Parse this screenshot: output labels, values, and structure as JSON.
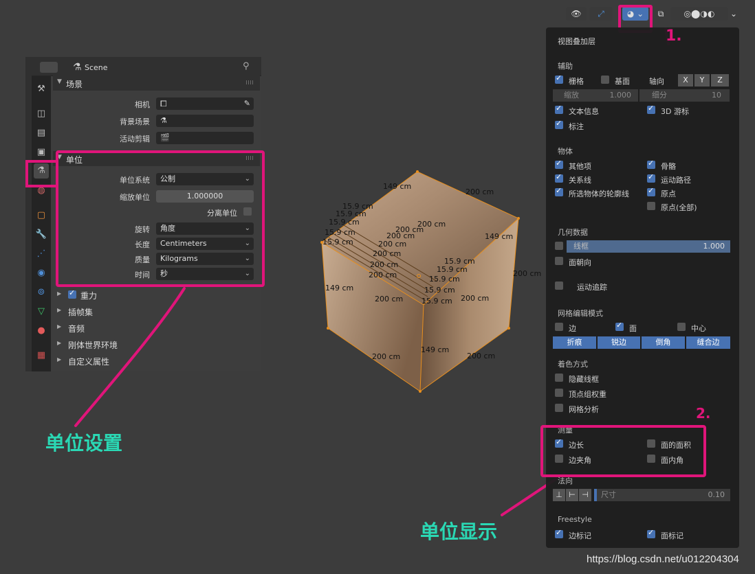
{
  "props": {
    "header_title": "Scene",
    "scene_section": "场景",
    "camera_label": "相机",
    "bg_scene_label": "背景场景",
    "active_clip_label": "活动剪辑",
    "units_section": "单位",
    "unit_system_label": "单位系统",
    "unit_system_value": "公制",
    "unit_scale_label": "缩放单位",
    "unit_scale_value": "1.000000",
    "separate_units_label": "分离单位",
    "rotation_label": "旋转",
    "rotation_value": "角度",
    "length_label": "长度",
    "length_value": "Centimeters",
    "mass_label": "质量",
    "mass_value": "Kilograms",
    "time_label": "时间",
    "time_value": "秒",
    "gravity_label": "重力",
    "keying_sets_label": "插帧集",
    "audio_label": "音频",
    "rigid_body_label": "刚体世界环境",
    "custom_props_label": "自定义属性"
  },
  "cube_labels": {
    "a": "149 cm",
    "b": "200 cm",
    "c": "149 cm",
    "d": "200 cm",
    "e": "200 cm",
    "f": "149 cm",
    "g": "200 cm",
    "h": "200 cm",
    "i": "149 cm",
    "j": "200 cm",
    "k": "200 cm",
    "l": "200 cm",
    "m": "200 cm",
    "n": "200 cm",
    "o": "200 cm",
    "p": "200 cm",
    "s1": "15.9 cm",
    "s2": "15.9 cm",
    "s3": "15.9 cm",
    "s4": "15.9 cm",
    "s5": "15.9 cm",
    "t1": "15.9 cm",
    "t2": "15.9 cm",
    "t3": "15.9 cm",
    "t4": "15.9 cm",
    "t5": "15.9 cm",
    "t6": "15.9 cm"
  },
  "overlay": {
    "title": "视图叠加层",
    "guides": "辅助",
    "grid": "栅格",
    "floor": "基面",
    "axes": "轴向",
    "axis_x": "X",
    "axis_y": "Y",
    "axis_z": "Z",
    "scale_label": "缩放",
    "scale_value": "1.000",
    "subdiv_label": "细分",
    "subdiv_value": "10",
    "text_info": "文本信息",
    "cursor_3d": "3D 游标",
    "annotations": "标注",
    "objects": "物体",
    "extras": "其他项",
    "bones": "骨骼",
    "relations": "关系线",
    "motion_paths": "运动路径",
    "outline": "所选物体的轮廓线",
    "origins": "原点",
    "origins_all": "原点(全部)",
    "geometry": "几何数据",
    "wireframe": "线框",
    "wireframe_value": "1.000",
    "face_orientation": "面朝向",
    "motion_tracking": "运动追踪",
    "mesh_edit": "网格编辑模式",
    "edges": "边",
    "faces": "面",
    "center": "中心",
    "crease": "折痕",
    "sharp": "锐边",
    "bevel": "倒角",
    "seams": "缝合边",
    "shading": "着色方式",
    "hidden_wire": "隐藏线框",
    "vertex_weights": "顶点组权重",
    "mesh_analysis": "网格分析",
    "measurement": "测量",
    "edge_length": "边长",
    "face_area": "面的面积",
    "edge_angle": "边夹角",
    "face_angle": "面内角",
    "normals": "法向",
    "normal_size_label": "尺寸",
    "normal_size_value": "0.10",
    "freestyle": "Freestyle",
    "edge_marks": "边标记",
    "face_marks": "面标记"
  },
  "annotations": {
    "unit_settings": "单位设置",
    "unit_display": "单位显示",
    "mark_1": "1.",
    "mark_2": "2."
  },
  "watermark": "https://blog.csdn.net/u012204304",
  "colors": {
    "accent": "#4772b3",
    "highlight": "#e0157a",
    "note": "#2ad8b4",
    "cube_edge": "#e88f1e"
  }
}
